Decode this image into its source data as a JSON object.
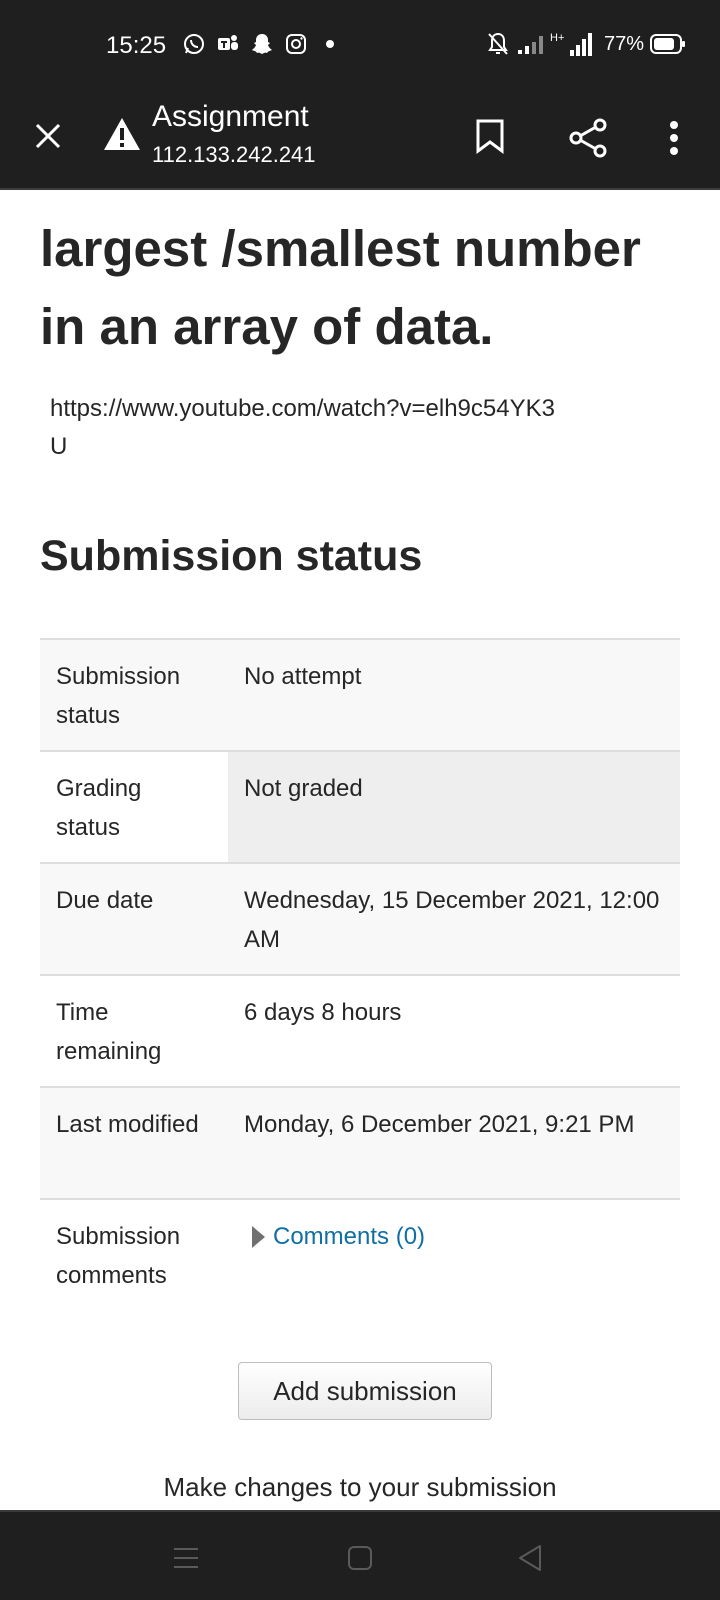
{
  "status_bar": {
    "time": "15:25",
    "app_icons": [
      "whatsapp-icon",
      "teams-icon",
      "snapchat-icon",
      "instagram-icon",
      "dot-icon"
    ],
    "battery_percent": "77%",
    "network_label": "H+"
  },
  "toolbar": {
    "title": "Assignment",
    "url": "112.133.242.241"
  },
  "content": {
    "heading": "largest /smallest number in an array of data.",
    "link_text": "https://www.youtube.com/watch?v=elh9c54YK3U",
    "section_title": "Submission status",
    "rows": [
      {
        "label": "Submission status",
        "value": "No attempt"
      },
      {
        "label": "Grading status",
        "value": "Not graded"
      },
      {
        "label": "Due date",
        "value": "Wednesday, 15 December 2021, 12:00 AM"
      },
      {
        "label": "Time remaining",
        "value": "6 days 8 hours"
      },
      {
        "label": "Last modified",
        "value": "Monday, 6 December 2021, 9:21 PM"
      },
      {
        "label": "Submission comments",
        "value": "Comments (0)"
      }
    ],
    "add_button": "Add submission",
    "changes_text": "Make changes to your submission"
  },
  "colors": {
    "bar_background": "#1f1f1f",
    "link": "#0f6fa5",
    "text": "#262626",
    "row_shade": "#f8f8f8",
    "highlight_cell": "#eeeeee"
  }
}
